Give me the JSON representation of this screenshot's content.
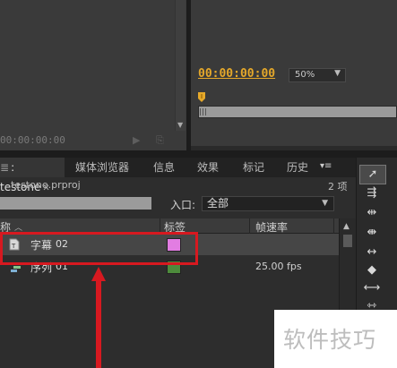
{
  "source_monitor": {
    "timecode": "00:00:00:00",
    "icon_a": "camera-icon",
    "icon_b": "export-frame-icon"
  },
  "program_monitor": {
    "timecode": "00:00:00:00",
    "zoom": "50%"
  },
  "project_panel": {
    "tabs": [
      {
        "label": ": testone",
        "active": true,
        "closable": true
      },
      {
        "label": "媒体浏览器"
      },
      {
        "label": "信息"
      },
      {
        "label": "效果"
      },
      {
        "label": "标记"
      },
      {
        "label": "历史"
      }
    ],
    "menu_glyph": "▾≡",
    "project_file": "testone.prproj",
    "item_count": "2 项",
    "inpoint_label": "入口:",
    "inpoint_value": "全部",
    "columns": {
      "name": "称",
      "label": "标签",
      "framerate": "帧速率"
    },
    "items": [
      {
        "name": "字幕",
        "id": "02",
        "label_color": "#e27de2",
        "framerate": ""
      },
      {
        "name": "序列",
        "id": "01",
        "label_color": "#4d8b3c",
        "framerate": "25.00 fps"
      }
    ]
  },
  "tools": [
    "selection-tool-icon",
    "track-select-icon",
    "ripple-edit-icon",
    "rolling-edit-icon",
    "rate-stretch-icon",
    "razor-icon",
    "slip-icon",
    "slide-icon"
  ],
  "watermark": "软件技巧",
  "colors": {
    "timecode_accent": "#e5a82a",
    "annotation_red": "#d71920"
  }
}
